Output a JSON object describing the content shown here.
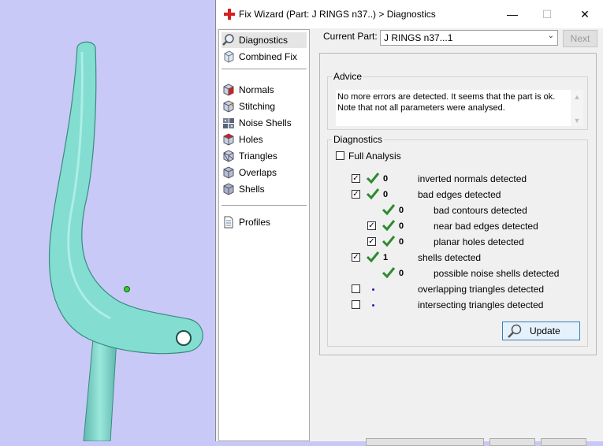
{
  "window": {
    "title": "Fix Wizard (Part: J RINGS n37..) > Diagnostics",
    "minimize_glyph": "—",
    "maximize_glyph": "☐",
    "close_glyph": "✕"
  },
  "nav": {
    "items": [
      {
        "label": "Diagnostics",
        "icon": "magnifier-icon",
        "selected": true
      },
      {
        "label": "Combined Fix",
        "icon": "cube-icon"
      },
      {
        "label": "Normals",
        "icon": "normals-cube-icon"
      },
      {
        "label": "Stitching",
        "icon": "stitching-cube-icon"
      },
      {
        "label": "Noise Shells",
        "icon": "noise-shells-icon"
      },
      {
        "label": "Holes",
        "icon": "holes-cube-icon"
      },
      {
        "label": "Triangles",
        "icon": "triangles-cube-icon"
      },
      {
        "label": "Overlaps",
        "icon": "overlaps-cube-icon"
      },
      {
        "label": "Shells",
        "icon": "shells-cube-icon"
      },
      {
        "label": "Profiles",
        "icon": "document-icon"
      }
    ]
  },
  "header": {
    "current_part_label": "Current Part:",
    "current_part_value": "J RINGS n37...1",
    "next_label": "Next"
  },
  "advice": {
    "legend": "Advice",
    "line1": "No more errors are detected. It seems that the part is ok.",
    "line2": "Note that not all parameters were analysed."
  },
  "diagnostics": {
    "legend": "Diagnostics",
    "full_analysis_label": "Full Analysis",
    "full_analysis_checked": false,
    "rows": [
      {
        "count": "0",
        "label": "inverted normals detected",
        "checked": true,
        "status": "ok"
      },
      {
        "count": "0",
        "label": "bad edges detected",
        "checked": true,
        "status": "ok"
      },
      {
        "count": "0",
        "label": "bad contours detected",
        "checked": null,
        "status": "ok"
      },
      {
        "count": "0",
        "label": "near bad edges detected",
        "checked": true,
        "status": "ok"
      },
      {
        "count": "0",
        "label": "planar holes detected",
        "checked": true,
        "status": "ok"
      },
      {
        "count": "1",
        "label": "shells detected",
        "checked": true,
        "status": "ok"
      },
      {
        "count": "0",
        "label": "possible noise shells detected",
        "checked": null,
        "status": "ok"
      },
      {
        "count": "",
        "label": "overlapping triangles detected",
        "checked": false,
        "status": "not-run"
      },
      {
        "count": "",
        "label": "intersecting triangles detected",
        "checked": false,
        "status": "not-run"
      }
    ],
    "update_label": "Update"
  },
  "colors": {
    "viewport_bg": "#c9c9f7",
    "part_fill": "#7fd8cc",
    "check_green": "#2e8b2e",
    "title_icon_red": "#d42020"
  }
}
